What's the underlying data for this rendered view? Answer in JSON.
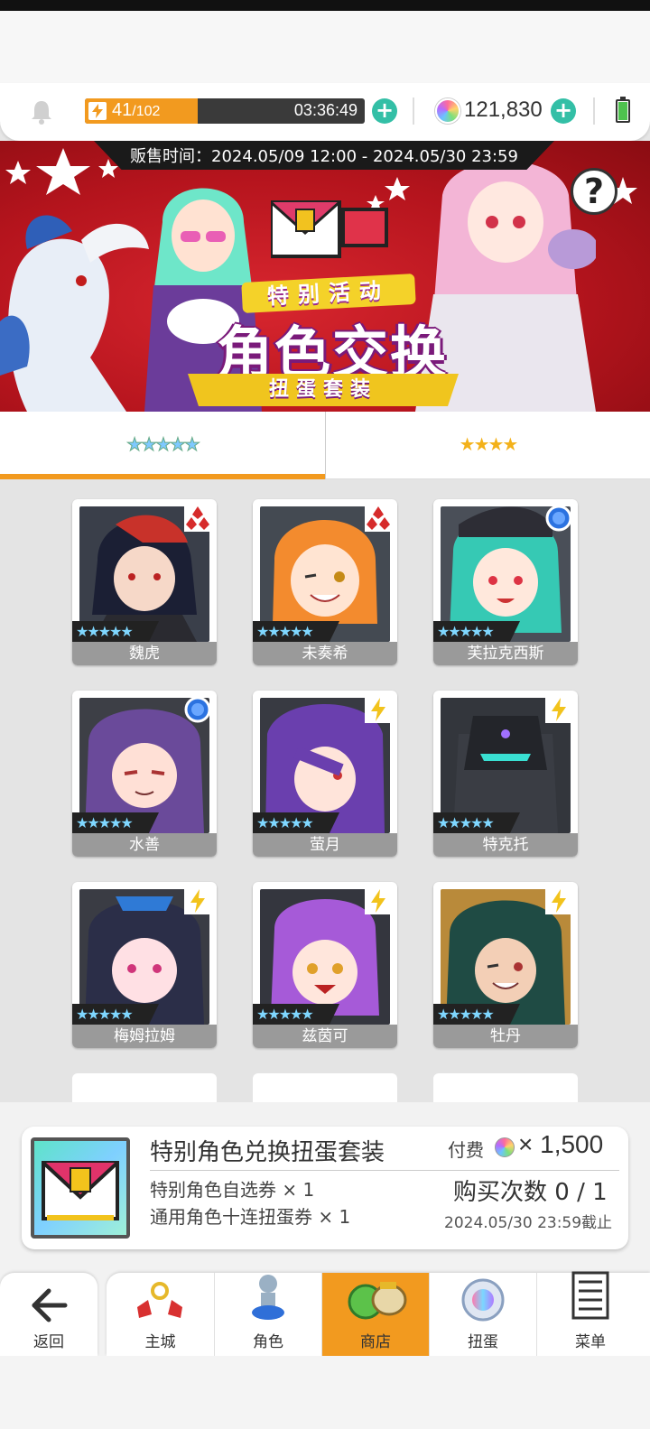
{
  "resources": {
    "stamina_current": "41",
    "stamina_max": "/102",
    "stamina_fraction": 0.402,
    "timer": "03:36:49",
    "gems": "121,830"
  },
  "banner": {
    "sale_period": "贩售时间：2024.05/09 12:00 - 2024.05/30 23:59",
    "tag": "特别活动",
    "title": "角色交换",
    "subtitle": "扭蛋套装",
    "help": "?"
  },
  "tabs": [
    {
      "stars": "★★★★★",
      "active": true
    },
    {
      "stars": "★★★★",
      "active": false
    }
  ],
  "characters": [
    {
      "name": "魏虎",
      "attribute": "red-diamond-icon",
      "stars": "★★★★★"
    },
    {
      "name": "未奏希",
      "attribute": "red-diamond-icon",
      "stars": "★★★★★"
    },
    {
      "name": "芙拉克西斯",
      "attribute": "blue-orb-icon",
      "stars": "★★★★★"
    },
    {
      "name": "水善",
      "attribute": "blue-orb-icon",
      "stars": "★★★★★"
    },
    {
      "name": "萤月",
      "attribute": "lightning-icon",
      "stars": "★★★★★"
    },
    {
      "name": "特克托",
      "attribute": "lightning-icon",
      "stars": "★★★★★"
    },
    {
      "name": "梅姆拉姆",
      "attribute": "lightning-icon",
      "stars": "★★★★★"
    },
    {
      "name": "兹茵可",
      "attribute": "lightning-icon",
      "stars": "★★★★★"
    },
    {
      "name": "牡丹",
      "attribute": "lightning-icon",
      "stars": "★★★★★"
    }
  ],
  "purchase": {
    "title": "特别角色兑换扭蛋套装",
    "line1": "特别角色自选券 × 1",
    "line2": "通用角色十连扭蛋券 × 1",
    "price_label": "付费",
    "price_value": "× 1,500",
    "buy_count": "购买次数 0 / 1",
    "deadline": "2024.05/30 23:59截止"
  },
  "nav": {
    "back": "返回",
    "items": [
      "主城",
      "角色",
      "商店",
      "扭蛋",
      "菜单"
    ],
    "active": "商店"
  },
  "colors": {
    "accent": "#f29a1f",
    "teal": "#33bfa6",
    "banner_red": "#c41820"
  }
}
